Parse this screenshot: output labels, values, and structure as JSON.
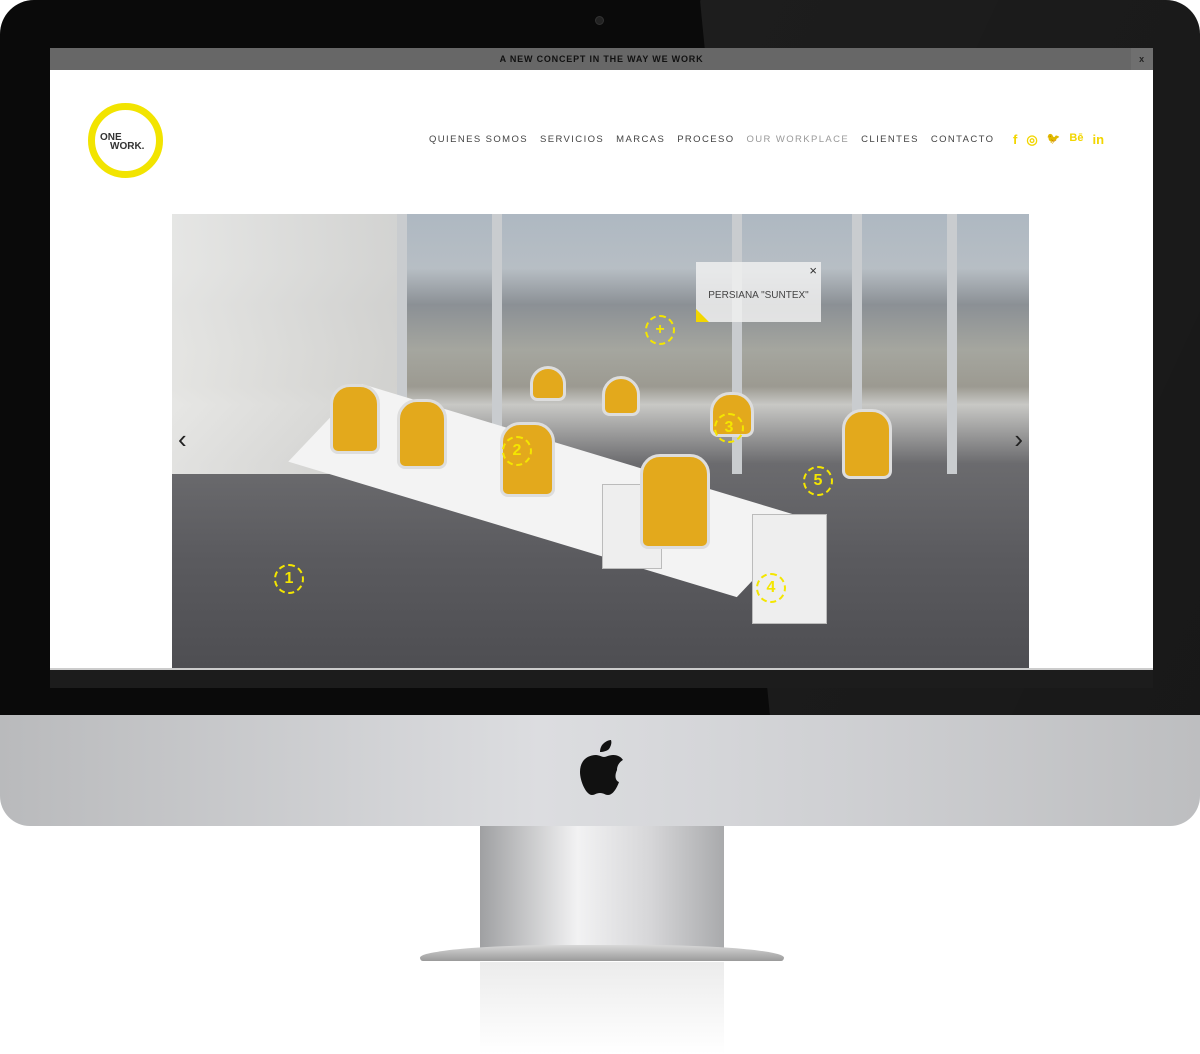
{
  "topbar": {
    "text": "A NEW CONCEPT IN THE WAY WE WORK",
    "close": "x"
  },
  "logo": {
    "line1": "ONE",
    "line2": "WORK."
  },
  "nav": [
    {
      "label": "QUIENES SOMOS"
    },
    {
      "label": "SERVICIOS"
    },
    {
      "label": "MARCAS"
    },
    {
      "label": "PROCESO"
    },
    {
      "label": "OUR WORKPLACE",
      "active": true
    },
    {
      "label": "CLIENTES"
    },
    {
      "label": "CONTACTO"
    }
  ],
  "social": {
    "facebook": "f",
    "instagram": "◎",
    "twitter": "🐦",
    "behance": "Bē",
    "linkedin": "in"
  },
  "hero": {
    "tooltip": {
      "text": "PERSIANA \"SUNTEX\"",
      "close": "×"
    },
    "hotspots": [
      "+",
      "1",
      "2",
      "3",
      "4",
      "5"
    ],
    "prev": "‹",
    "next": "›"
  },
  "colors": {
    "accent": "#f2e400"
  }
}
